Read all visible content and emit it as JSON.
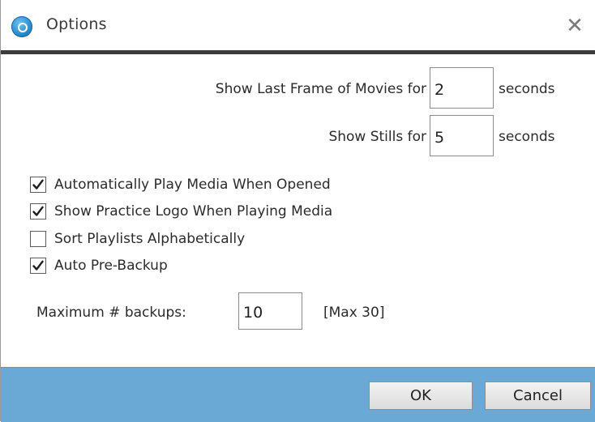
{
  "window": {
    "title": "Options",
    "app_icon": "app-logo-icon",
    "close_icon": "close-icon",
    "close_glyph": "✕"
  },
  "timing": {
    "last_frame_label": "Show Last Frame of Movies for",
    "last_frame_value": "2",
    "last_frame_unit": "seconds",
    "stills_label": "Show Stills for",
    "stills_value": "5",
    "stills_unit": "seconds"
  },
  "options": [
    {
      "label": "Automatically Play Media When Opened",
      "checked": true
    },
    {
      "label": "Show Practice Logo When Playing Media",
      "checked": true
    },
    {
      "label": "Sort Playlists Alphabetically",
      "checked": false
    },
    {
      "label": "Auto Pre-Backup",
      "checked": true
    }
  ],
  "backups": {
    "label": "Maximum # backups:",
    "value": "10",
    "hint": "[Max 30]"
  },
  "footer": {
    "ok_label": "OK",
    "cancel_label": "Cancel"
  },
  "colors": {
    "footer_bg": "#6aa9d6",
    "title_separator": "#3c3c3c"
  }
}
